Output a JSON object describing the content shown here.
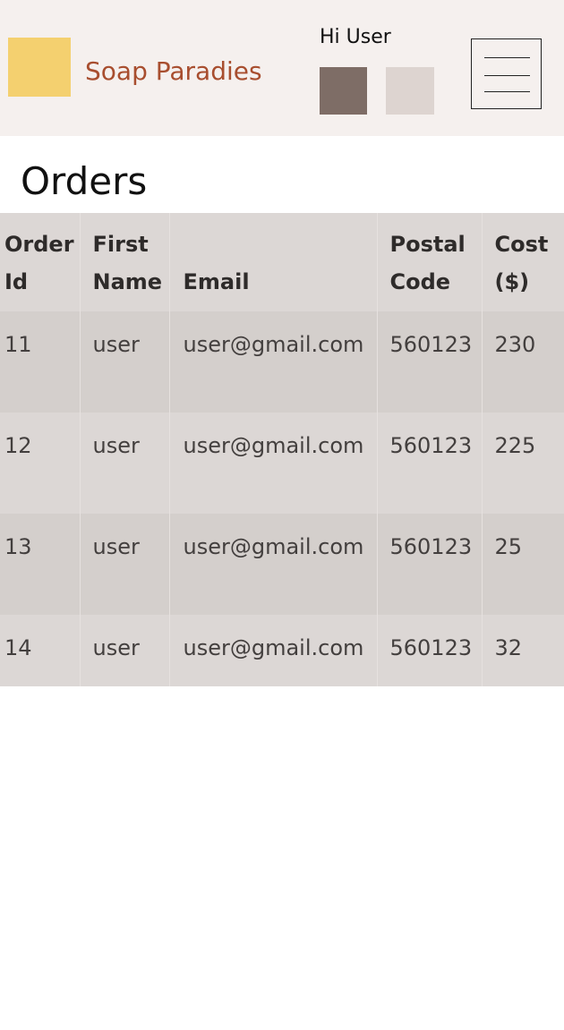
{
  "header": {
    "brand_name": "Soap Paradies",
    "greeting": "Hi User",
    "colors": {
      "background": "#f5f0ee",
      "logo": "#f4d06f",
      "brand_text": "#a84e2f",
      "button_dark": "#7e6d66",
      "button_light": "#ddd4d0"
    },
    "menu_icon": "hamburger-menu-icon"
  },
  "page": {
    "title": "Orders"
  },
  "table": {
    "columns": [
      "Order Id",
      "First Name",
      "Email",
      "Postal Code",
      "Cost ($)"
    ],
    "rows": [
      [
        "11",
        "user",
        "user@gmail.com",
        "560123",
        "230"
      ],
      [
        "12",
        "user",
        "user@gmail.com",
        "560123",
        "225"
      ],
      [
        "13",
        "user",
        "user@gmail.com",
        "560123",
        "25"
      ],
      [
        "14",
        "user",
        "user@gmail.com",
        "560123",
        "32"
      ]
    ],
    "colors": {
      "header_bg": "#dcd7d5",
      "row_odd_bg": "#d4cfcc",
      "row_even_bg": "#dcd7d5"
    }
  }
}
